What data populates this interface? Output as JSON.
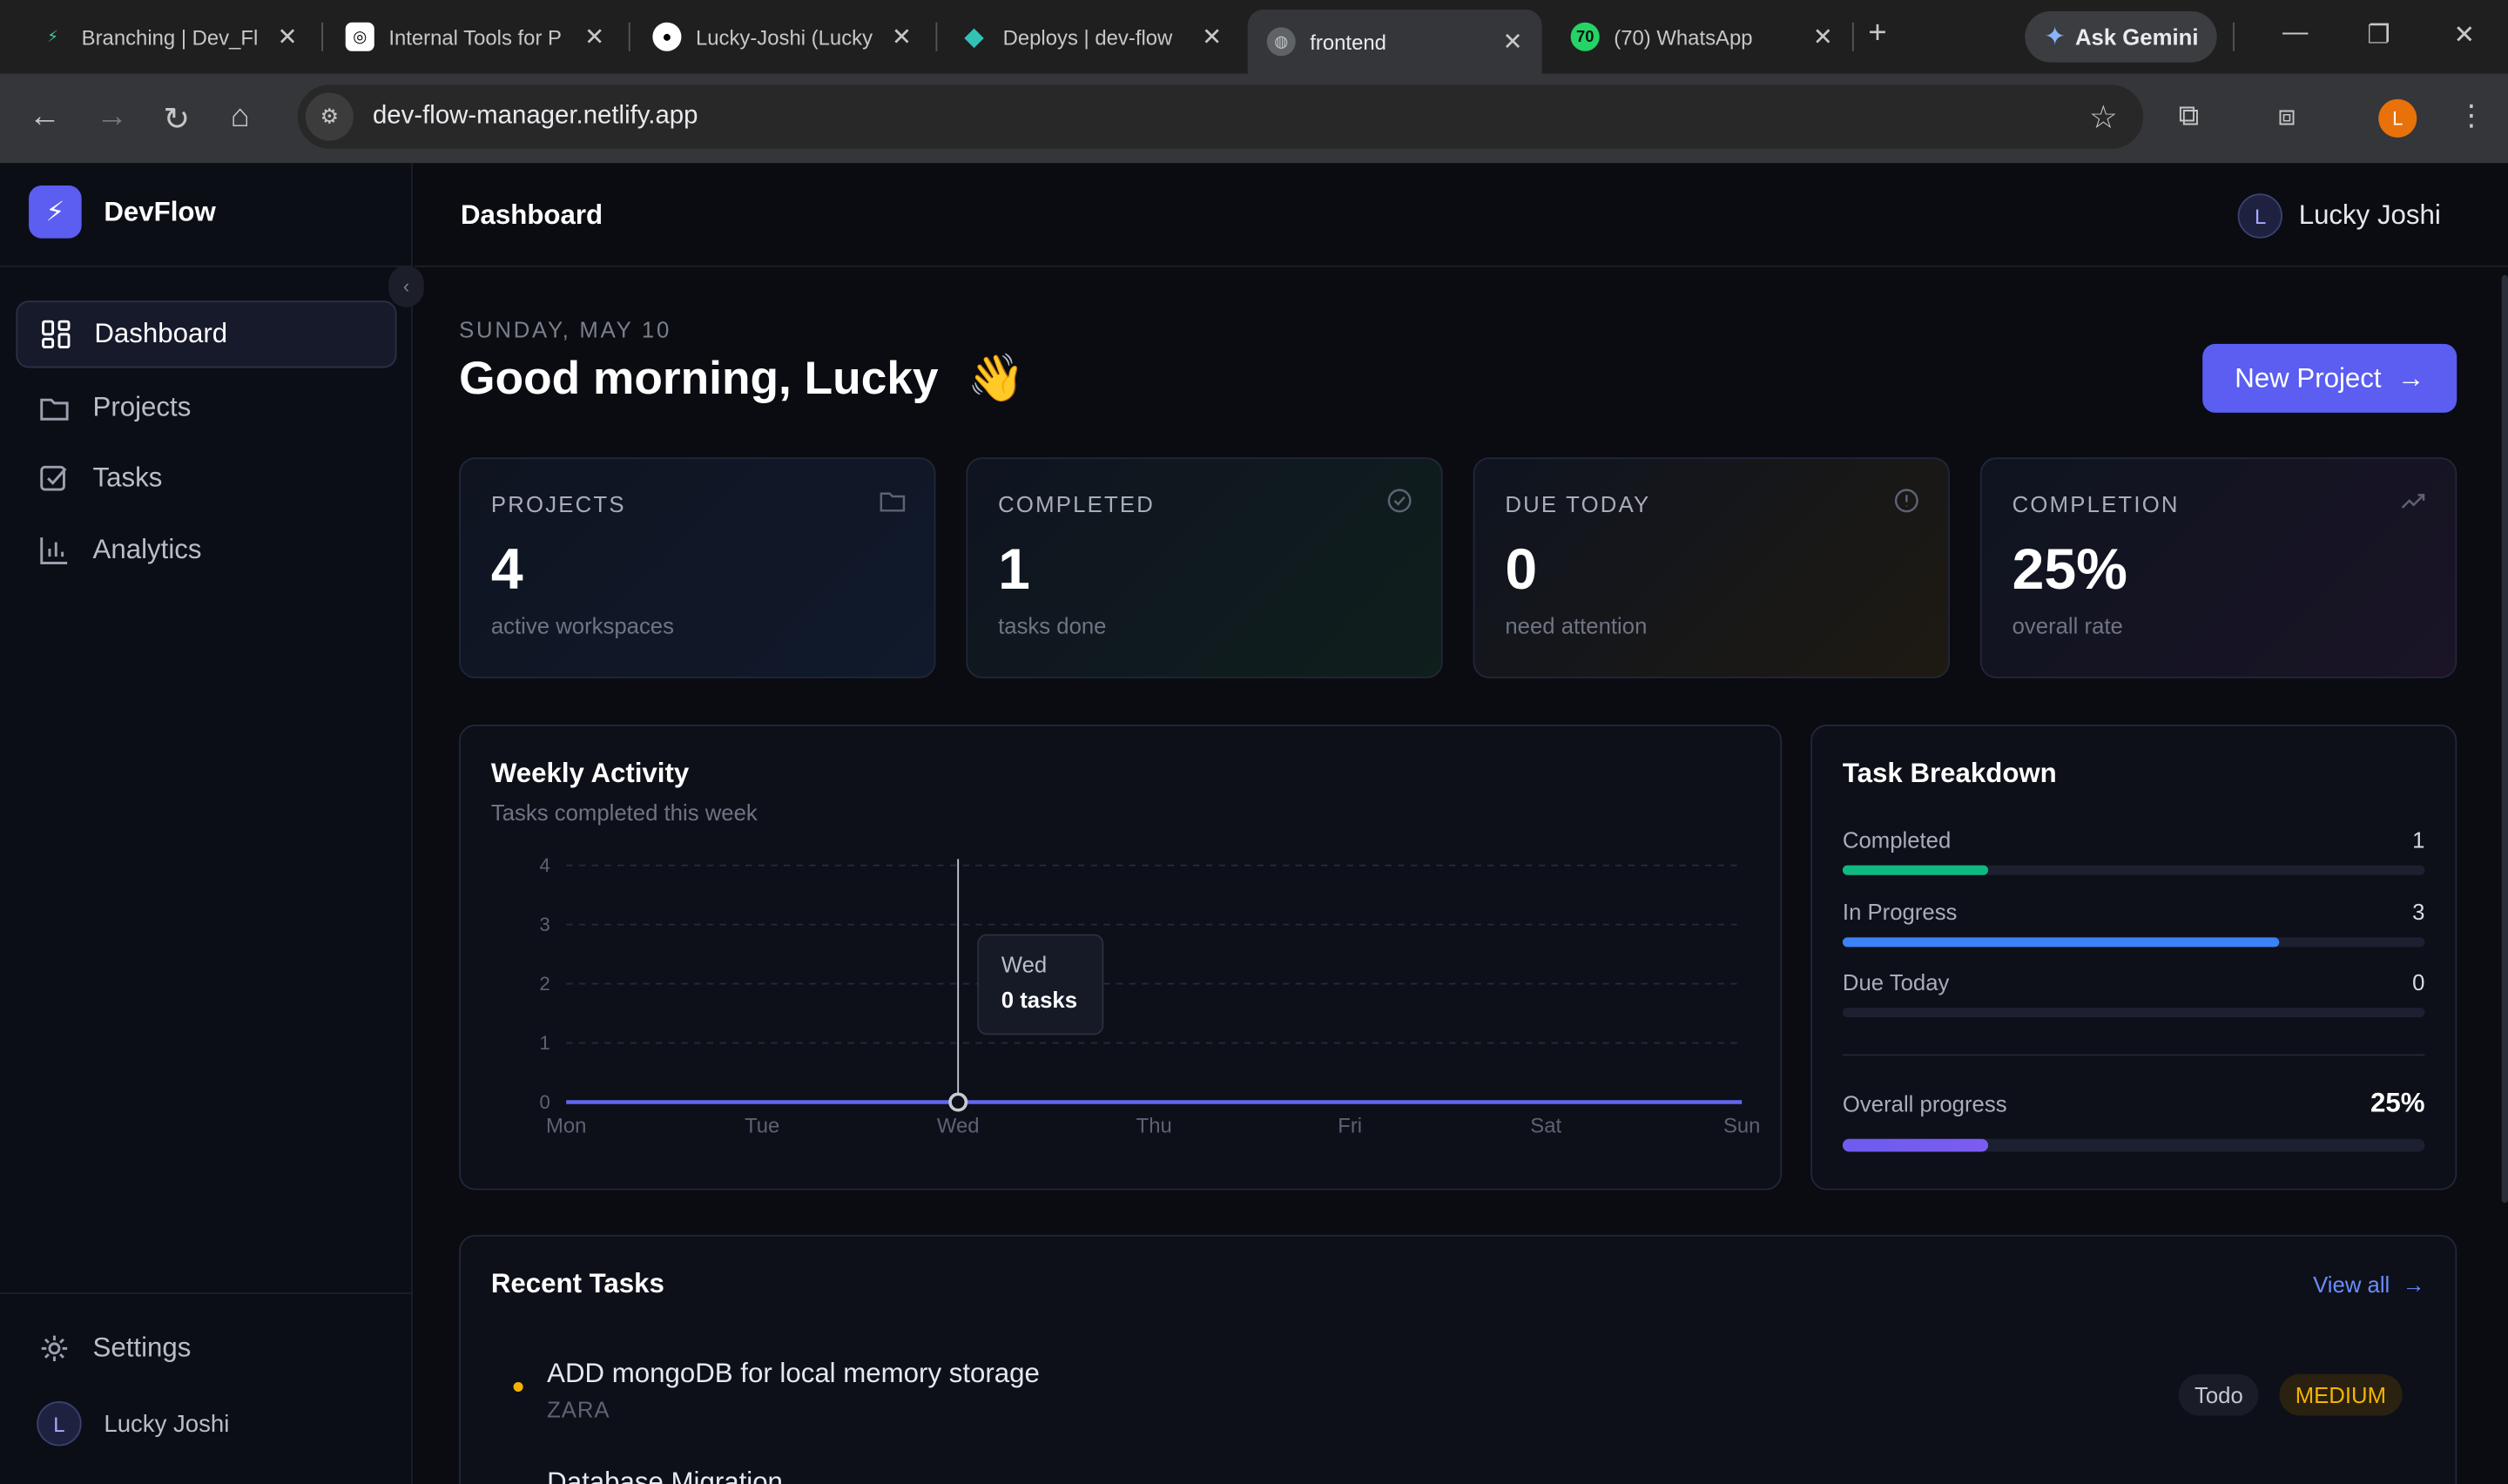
{
  "browser": {
    "tabs": [
      {
        "label": "Branching | Dev_Fl",
        "favicon": "bolt-icon",
        "color": "#3ecf8e"
      },
      {
        "label": "Internal Tools for P",
        "favicon": "openai-icon",
        "color": "#ffffff"
      },
      {
        "label": "Lucky-Joshi (Lucky",
        "favicon": "github-icon",
        "color": "#ffffff"
      },
      {
        "label": "Deploys | dev-flow",
        "favicon": "netlify-icon",
        "color": "#32c3b6"
      },
      {
        "label": "frontend",
        "favicon": "globe-icon",
        "color": "#c7c7c7"
      },
      {
        "label": "(70) WhatsApp",
        "favicon": "whatsapp-icon",
        "color": "#25d366",
        "badge": "70"
      }
    ],
    "gemini_label": "Ask Gemini",
    "url": "dev-flow-manager.netlify.app",
    "profile_initial": "L"
  },
  "sidebar": {
    "brand": "DevFlow",
    "items": [
      {
        "label": "Dashboard",
        "icon": "dashboard-icon",
        "active": true
      },
      {
        "label": "Projects",
        "icon": "folder-icon",
        "active": false
      },
      {
        "label": "Tasks",
        "icon": "checkbox-icon",
        "active": false
      },
      {
        "label": "Analytics",
        "icon": "bar-chart-icon",
        "active": false
      }
    ],
    "settings_label": "Settings",
    "user_initial": "L",
    "user_name": "Lucky Joshi"
  },
  "header": {
    "title": "Dashboard",
    "user_initial": "L",
    "user_name": "Lucky Joshi"
  },
  "hero": {
    "date": "SUNDAY, MAY 10",
    "greeting": "Good morning, Lucky",
    "wave": "👋",
    "new_project_label": "New Project"
  },
  "stats": [
    {
      "label": "PROJECTS",
      "value": "4",
      "sub": "active workspaces",
      "icon": "folder-icon"
    },
    {
      "label": "COMPLETED",
      "value": "1",
      "sub": "tasks done",
      "icon": "check-circle-icon"
    },
    {
      "label": "DUE TODAY",
      "value": "0",
      "sub": "need attention",
      "icon": "alert-circle-icon"
    },
    {
      "label": "COMPLETION",
      "value": "25%",
      "sub": "overall rate",
      "icon": "trending-up-icon"
    }
  ],
  "weekly": {
    "title": "Weekly Activity",
    "subtitle": "Tasks completed this week",
    "tooltip_day": "Wed",
    "tooltip_value": "0 tasks"
  },
  "chart_data": {
    "type": "line",
    "categories": [
      "Mon",
      "Tue",
      "Wed",
      "Thu",
      "Fri",
      "Sat",
      "Sun"
    ],
    "values": [
      0,
      0,
      0,
      0,
      0,
      0,
      0
    ],
    "yticks": [
      "0",
      "1",
      "2",
      "3",
      "4"
    ],
    "ylim": [
      0,
      4
    ],
    "grid": true,
    "highlight_index": 2,
    "line_color": "#6366f1"
  },
  "breakdown": {
    "title": "Task Breakdown",
    "rows": [
      {
        "label": "Completed",
        "value": "1",
        "fraction": 0.25,
        "color": "#10b981"
      },
      {
        "label": "In Progress",
        "value": "3",
        "fraction": 0.75,
        "color": "#3b82f6"
      },
      {
        "label": "Due Today",
        "value": "0",
        "fraction": 0,
        "color": "#f59e0b"
      }
    ],
    "overall_label": "Overall progress",
    "overall_value": "25%",
    "overall_fraction": 0.25,
    "overall_color": "#7c5cf0"
  },
  "recent": {
    "title": "Recent Tasks",
    "view_all": "View all",
    "tasks": [
      {
        "name": "ADD mongoDB for local memory storage",
        "project": "ZARA",
        "status": "Todo",
        "priority": "MEDIUM"
      },
      {
        "name": "Database Migration",
        "project": "",
        "status": "",
        "priority": ""
      }
    ]
  }
}
